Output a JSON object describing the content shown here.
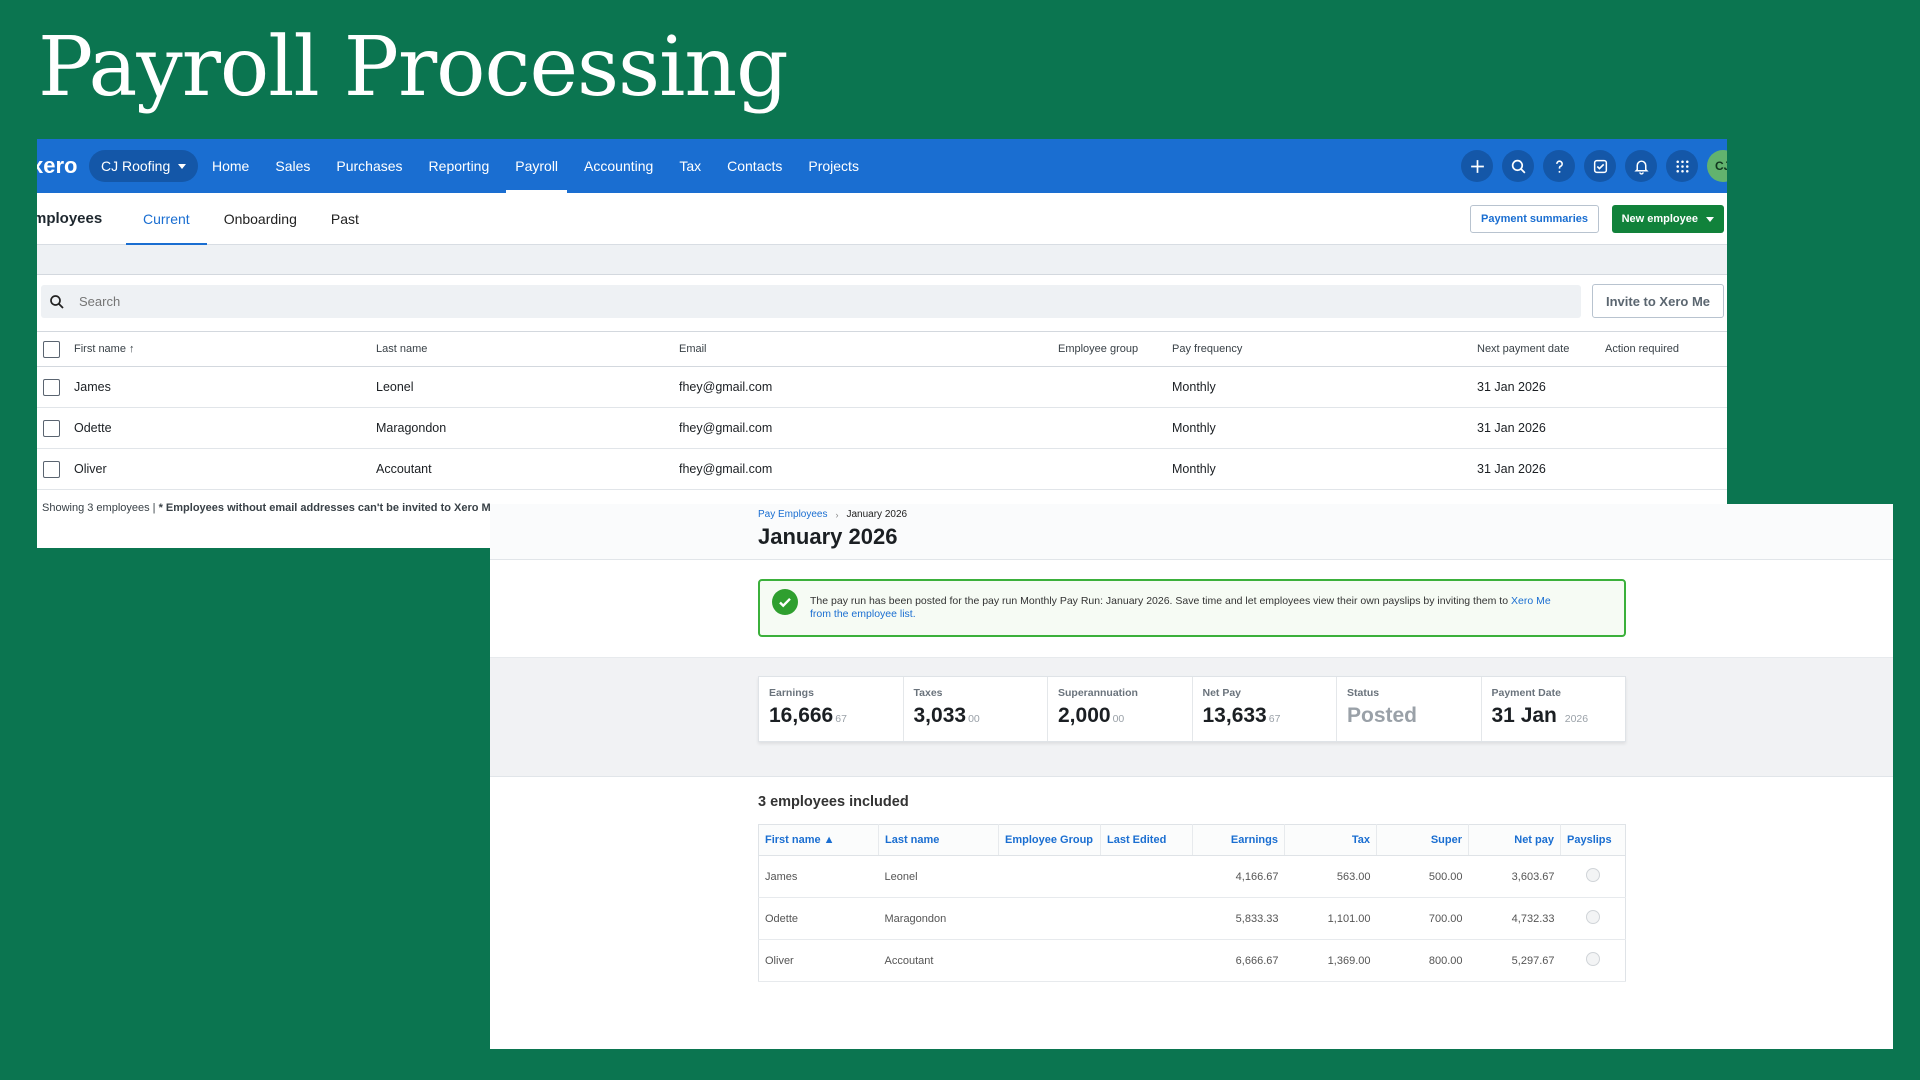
{
  "slide": {
    "title": "Payroll Processing"
  },
  "employees_page": {
    "nav": {
      "logo": "xero",
      "org": "CJ Roofing",
      "links": [
        "Home",
        "Sales",
        "Purchases",
        "Reporting",
        "Payroll",
        "Accounting",
        "Tax",
        "Contacts",
        "Projects"
      ],
      "active": "Payroll",
      "avatar": "CJ"
    },
    "page_title": "mployees",
    "tabs": [
      "Current",
      "Onboarding",
      "Past"
    ],
    "active_tab": "Current",
    "payment_summaries": "Payment summaries",
    "new_employee": "New employee",
    "search_placeholder": "Search",
    "invite_button": "Invite to Xero Me",
    "columns": {
      "first_name": "First name",
      "last_name": "Last name",
      "email": "Email",
      "employee_group": "Employee group",
      "pay_frequency": "Pay frequency",
      "next_payment_date": "Next payment date",
      "action_required": "Action required"
    },
    "rows": [
      {
        "first": "James",
        "last": "Leonel",
        "email": "fhey@gmail.com",
        "group": "",
        "frequency": "Monthly",
        "next_date": "31 Jan 2026",
        "action": ""
      },
      {
        "first": "Odette",
        "last": "Maragondon",
        "email": "fhey@gmail.com",
        "group": "",
        "frequency": "Monthly",
        "next_date": "31 Jan 2026",
        "action": ""
      },
      {
        "first": "Oliver",
        "last": "Accoutant",
        "email": "fhey@gmail.com",
        "group": "",
        "frequency": "Monthly",
        "next_date": "31 Jan 2026",
        "action": ""
      }
    ],
    "footer_count": "Showing 3 employees | ",
    "footer_bold": "* Employees without email addresses can't be invited to Xero M"
  },
  "payrun": {
    "breadcrumb_link": "Pay Employees",
    "breadcrumb_sep": "›",
    "breadcrumb_current": "January 2026",
    "title": "January 2026",
    "notice_text": "The pay run has been posted for the pay run Monthly Pay Run: January 2026. Save time and let employees view their own payslips by inviting them to ",
    "notice_link_1": "Xero Me",
    "notice_link_2": "from the employee list.",
    "stats": [
      {
        "label": "Earnings",
        "value": "16,666",
        "dec": "67"
      },
      {
        "label": "Taxes",
        "value": "3,033",
        "dec": "00"
      },
      {
        "label": "Superannuation",
        "value": "2,000",
        "dec": "00"
      },
      {
        "label": "Net Pay",
        "value": "13,633",
        "dec": "67"
      },
      {
        "label": "Status",
        "value": "Posted",
        "dec": ""
      },
      {
        "label": "Payment Date",
        "value": "31 Jan",
        "dec": "2026"
      }
    ],
    "employees_included": "3 employees included",
    "columns": [
      "First name ▲",
      "Last name",
      "Employee Group",
      "Last Edited",
      "Earnings",
      "Tax",
      "Super",
      "Net pay",
      "Payslips"
    ],
    "rows": [
      {
        "first": "James",
        "last": "Leonel",
        "group": "",
        "edited": "",
        "earnings": "4,166.67",
        "tax": "563.00",
        "super": "500.00",
        "net": "3,603.67"
      },
      {
        "first": "Odette",
        "last": "Maragondon",
        "group": "",
        "edited": "",
        "earnings": "5,833.33",
        "tax": "1,101.00",
        "super": "700.00",
        "net": "4,732.33"
      },
      {
        "first": "Oliver",
        "last": "Accoutant",
        "group": "",
        "edited": "",
        "earnings": "6,666.67",
        "tax": "1,369.00",
        "super": "800.00",
        "net": "5,297.67"
      }
    ]
  },
  "colors": {
    "background": "#0b7550",
    "xero_blue": "#1a6ed1",
    "green_button": "#11823b",
    "success_border": "#3bb03b"
  },
  "icons": [
    "plus-icon",
    "search-icon",
    "help-icon",
    "checklist-icon",
    "bell-icon",
    "apps-grid-icon",
    "check-icon",
    "sort-up-icon",
    "caret-down-icon"
  ]
}
